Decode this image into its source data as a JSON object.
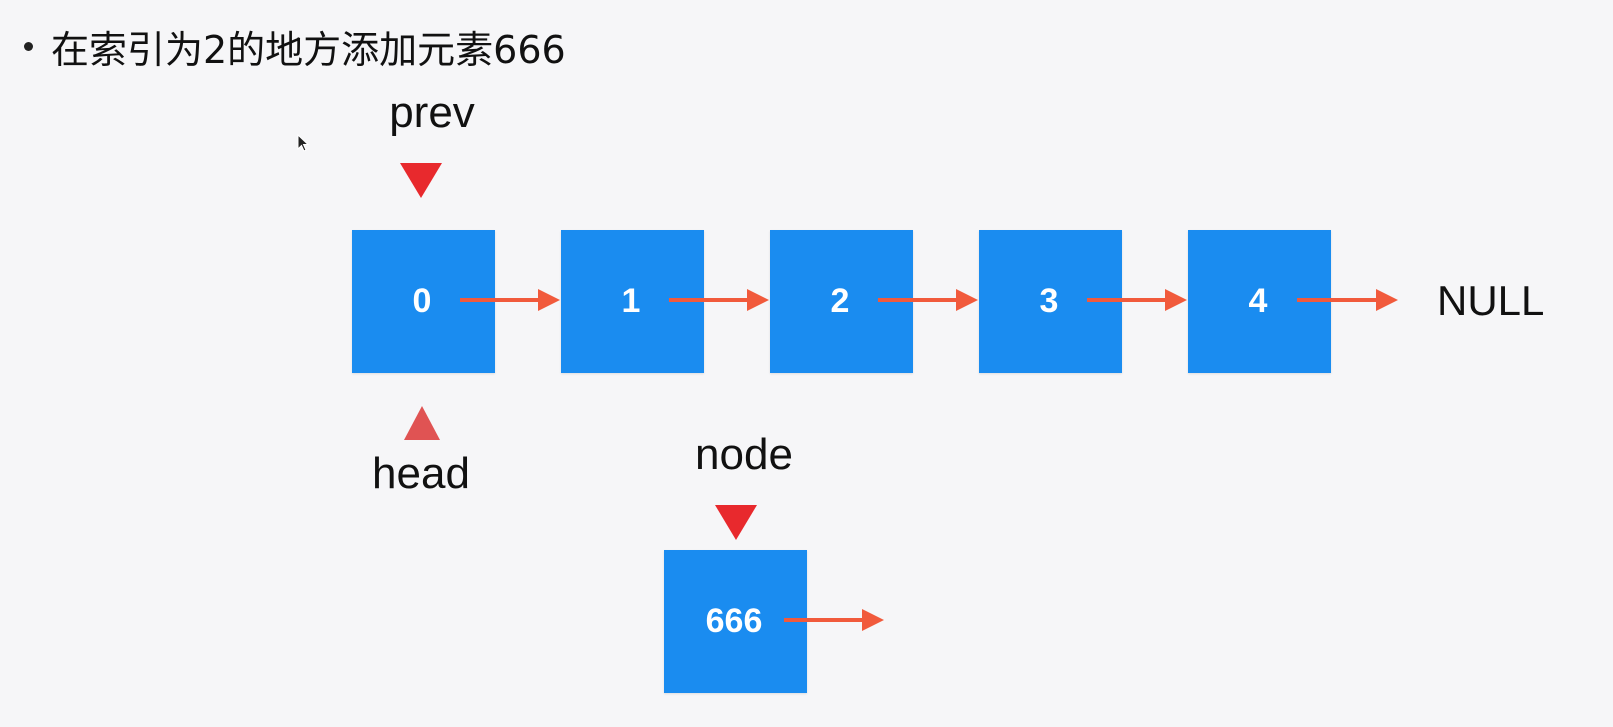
{
  "heading": {
    "text": "在索引为2的地方添加元素666"
  },
  "list": {
    "nodes": [
      "0",
      "1",
      "2",
      "3",
      "4"
    ],
    "terminal": "NULL"
  },
  "new_node": {
    "label": "666"
  },
  "pointers": {
    "prev": "prev",
    "head": "head",
    "node": "node"
  },
  "colors": {
    "node_fill": "#1a8cf0",
    "arrow": "#f15a3c",
    "marker": "#e8292d",
    "marker_head": "#e05353",
    "background": "#f6f6f8"
  },
  "icons": {
    "cursor": "mouse-pointer-icon",
    "bullet": "bullet-dot-icon"
  }
}
